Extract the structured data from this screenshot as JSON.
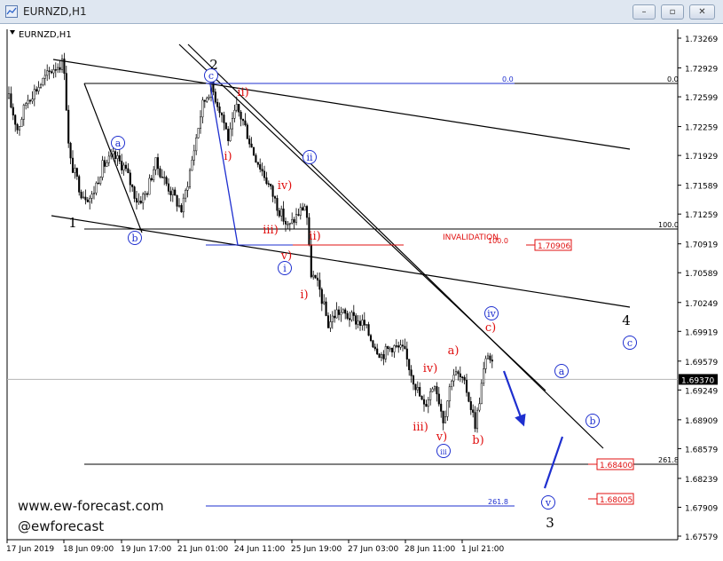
{
  "window": {
    "title": "EURNZD,H1",
    "chart_label": "EURNZD,H1",
    "buttons": {
      "minimize": "–",
      "restore": "▫",
      "close": "✕"
    }
  },
  "colors": {
    "blue": "#1e2fcf",
    "red": "#e01010",
    "black": "#000000",
    "price_line": "#b4b4b4",
    "candle": "#000000"
  },
  "chart_data": {
    "type": "candlestick",
    "symbol": "EURNZD",
    "timeframe": "H1",
    "ylim": [
      1.6744,
      1.7362
    ],
    "y_ticks": [
      "1.73269",
      "1.72929",
      "1.72599",
      "1.72259",
      "1.71929",
      "1.71589",
      "1.71259",
      "1.70919",
      "1.70589",
      "1.70249",
      "1.69919",
      "1.69579",
      "1.69249",
      "1.68909",
      "1.68579",
      "1.68239",
      "1.67909",
      "1.67579"
    ],
    "x_ticks": [
      "17 Jun 2019",
      "18 Jun 09:00",
      "19 Jun 17:00",
      "21 Jun 01:00",
      "24 Jun 11:00",
      "25 Jun 19:00",
      "27 Jun 03:00",
      "28 Jun 11:00",
      "1 Jul 21:00"
    ],
    "current_price": "1.69370",
    "price_markers": [
      "1.70906",
      "1.68400",
      "1.68005"
    ],
    "fib_labels": [
      {
        "text": "0.0",
        "color": "blue"
      },
      {
        "text": "0.0",
        "color": "black"
      },
      {
        "text": "100.0",
        "color": "black"
      },
      {
        "text": "100.0",
        "color": "red"
      },
      {
        "text": "261.8",
        "color": "black"
      },
      {
        "text": "261.8",
        "color": "blue"
      }
    ],
    "invalidation": "INVALIDATION",
    "wave_labels": [
      {
        "text": "2",
        "style": "plain",
        "color": "black"
      },
      {
        "text": "1",
        "style": "plain",
        "color": "black"
      },
      {
        "text": "4",
        "style": "plain",
        "color": "black"
      },
      {
        "text": "3",
        "style": "plain",
        "color": "black"
      },
      {
        "text": "c",
        "style": "circle",
        "color": "blue"
      },
      {
        "text": "a",
        "style": "circle",
        "color": "blue"
      },
      {
        "text": "b",
        "style": "circle",
        "color": "blue"
      },
      {
        "text": "ii",
        "style": "circle",
        "color": "blue"
      },
      {
        "text": "i",
        "style": "circle",
        "color": "blue"
      },
      {
        "text": "iii",
        "style": "circle",
        "color": "blue"
      },
      {
        "text": "iv",
        "style": "circle",
        "color": "blue"
      },
      {
        "text": "c",
        "style": "circle",
        "color": "blue"
      },
      {
        "text": "a",
        "style": "circle",
        "color": "blue"
      },
      {
        "text": "b",
        "style": "circle",
        "color": "blue"
      },
      {
        "text": "v",
        "style": "circle",
        "color": "blue"
      },
      {
        "text": "ii)",
        "style": "paren",
        "color": "red"
      },
      {
        "text": "i)",
        "style": "paren",
        "color": "red"
      },
      {
        "text": "iv)",
        "style": "paren",
        "color": "red"
      },
      {
        "text": "iii)",
        "style": "paren",
        "color": "red"
      },
      {
        "text": "ii)",
        "style": "paren",
        "color": "red"
      },
      {
        "text": "v)",
        "style": "paren",
        "color": "red"
      },
      {
        "text": "i)",
        "style": "paren",
        "color": "red"
      },
      {
        "text": "iv)",
        "style": "paren",
        "color": "red"
      },
      {
        "text": "a)",
        "style": "paren",
        "color": "red"
      },
      {
        "text": "c)",
        "style": "paren",
        "color": "red"
      },
      {
        "text": "iii)",
        "style": "paren",
        "color": "red"
      },
      {
        "text": "v)",
        "style": "paren",
        "color": "red"
      },
      {
        "text": "b)",
        "style": "paren",
        "color": "red"
      }
    ],
    "watermark": [
      "www.ew-forecast.com",
      "@ewforecast"
    ],
    "grid": false
  }
}
